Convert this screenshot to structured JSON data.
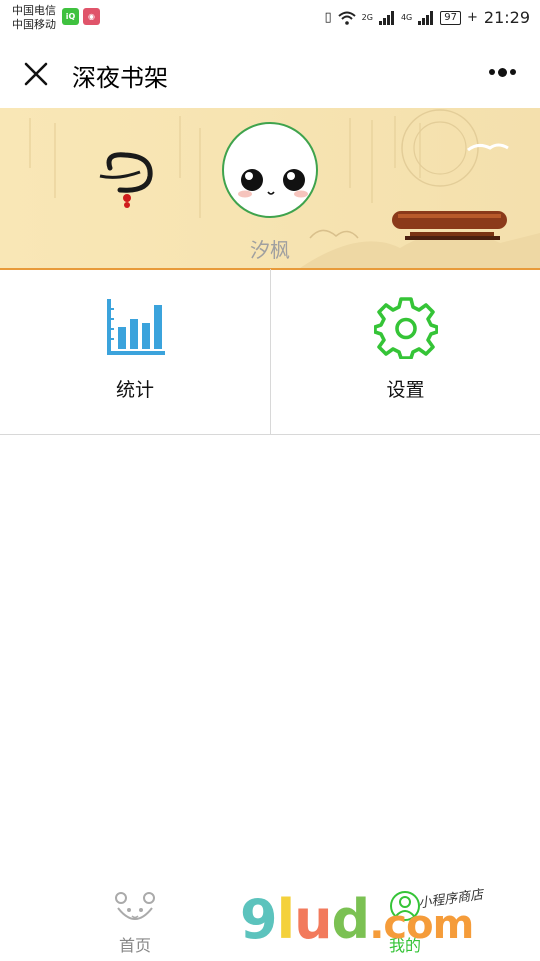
{
  "status_bar": {
    "carrier_1": "中国电信",
    "carrier_2": "中国移动",
    "signal_1": "2G",
    "signal_2": "4G",
    "battery": "97",
    "time": "21:29"
  },
  "navbar": {
    "title": "深夜书架"
  },
  "profile": {
    "name": "汐枫"
  },
  "menu": [
    {
      "label": "统计",
      "icon": "bar-chart-icon",
      "color": "#3ba3dc"
    },
    {
      "label": "设置",
      "icon": "gear-icon",
      "color": "#35c437"
    }
  ],
  "tabbar": {
    "home_label": "首页",
    "mine_label": "我的"
  },
  "watermark": {
    "brand_g": "9",
    "brand_l": "l",
    "brand_u": "u",
    "brand_d": "d",
    "brand_dot": ".",
    "brand_tld": "com",
    "tagline": "小程序商店"
  }
}
